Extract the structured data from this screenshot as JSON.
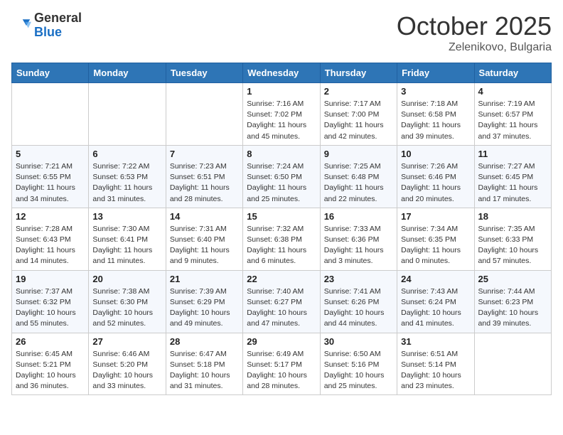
{
  "header": {
    "logo_general": "General",
    "logo_blue": "Blue",
    "month": "October 2025",
    "location": "Zelenikovo, Bulgaria"
  },
  "weekdays": [
    "Sunday",
    "Monday",
    "Tuesday",
    "Wednesday",
    "Thursday",
    "Friday",
    "Saturday"
  ],
  "weeks": [
    [
      {
        "day": "",
        "info": ""
      },
      {
        "day": "",
        "info": ""
      },
      {
        "day": "",
        "info": ""
      },
      {
        "day": "1",
        "info": "Sunrise: 7:16 AM\nSunset: 7:02 PM\nDaylight: 11 hours and 45 minutes."
      },
      {
        "day": "2",
        "info": "Sunrise: 7:17 AM\nSunset: 7:00 PM\nDaylight: 11 hours and 42 minutes."
      },
      {
        "day": "3",
        "info": "Sunrise: 7:18 AM\nSunset: 6:58 PM\nDaylight: 11 hours and 39 minutes."
      },
      {
        "day": "4",
        "info": "Sunrise: 7:19 AM\nSunset: 6:57 PM\nDaylight: 11 hours and 37 minutes."
      }
    ],
    [
      {
        "day": "5",
        "info": "Sunrise: 7:21 AM\nSunset: 6:55 PM\nDaylight: 11 hours and 34 minutes."
      },
      {
        "day": "6",
        "info": "Sunrise: 7:22 AM\nSunset: 6:53 PM\nDaylight: 11 hours and 31 minutes."
      },
      {
        "day": "7",
        "info": "Sunrise: 7:23 AM\nSunset: 6:51 PM\nDaylight: 11 hours and 28 minutes."
      },
      {
        "day": "8",
        "info": "Sunrise: 7:24 AM\nSunset: 6:50 PM\nDaylight: 11 hours and 25 minutes."
      },
      {
        "day": "9",
        "info": "Sunrise: 7:25 AM\nSunset: 6:48 PM\nDaylight: 11 hours and 22 minutes."
      },
      {
        "day": "10",
        "info": "Sunrise: 7:26 AM\nSunset: 6:46 PM\nDaylight: 11 hours and 20 minutes."
      },
      {
        "day": "11",
        "info": "Sunrise: 7:27 AM\nSunset: 6:45 PM\nDaylight: 11 hours and 17 minutes."
      }
    ],
    [
      {
        "day": "12",
        "info": "Sunrise: 7:28 AM\nSunset: 6:43 PM\nDaylight: 11 hours and 14 minutes."
      },
      {
        "day": "13",
        "info": "Sunrise: 7:30 AM\nSunset: 6:41 PM\nDaylight: 11 hours and 11 minutes."
      },
      {
        "day": "14",
        "info": "Sunrise: 7:31 AM\nSunset: 6:40 PM\nDaylight: 11 hours and 9 minutes."
      },
      {
        "day": "15",
        "info": "Sunrise: 7:32 AM\nSunset: 6:38 PM\nDaylight: 11 hours and 6 minutes."
      },
      {
        "day": "16",
        "info": "Sunrise: 7:33 AM\nSunset: 6:36 PM\nDaylight: 11 hours and 3 minutes."
      },
      {
        "day": "17",
        "info": "Sunrise: 7:34 AM\nSunset: 6:35 PM\nDaylight: 11 hours and 0 minutes."
      },
      {
        "day": "18",
        "info": "Sunrise: 7:35 AM\nSunset: 6:33 PM\nDaylight: 10 hours and 57 minutes."
      }
    ],
    [
      {
        "day": "19",
        "info": "Sunrise: 7:37 AM\nSunset: 6:32 PM\nDaylight: 10 hours and 55 minutes."
      },
      {
        "day": "20",
        "info": "Sunrise: 7:38 AM\nSunset: 6:30 PM\nDaylight: 10 hours and 52 minutes."
      },
      {
        "day": "21",
        "info": "Sunrise: 7:39 AM\nSunset: 6:29 PM\nDaylight: 10 hours and 49 minutes."
      },
      {
        "day": "22",
        "info": "Sunrise: 7:40 AM\nSunset: 6:27 PM\nDaylight: 10 hours and 47 minutes."
      },
      {
        "day": "23",
        "info": "Sunrise: 7:41 AM\nSunset: 6:26 PM\nDaylight: 10 hours and 44 minutes."
      },
      {
        "day": "24",
        "info": "Sunrise: 7:43 AM\nSunset: 6:24 PM\nDaylight: 10 hours and 41 minutes."
      },
      {
        "day": "25",
        "info": "Sunrise: 7:44 AM\nSunset: 6:23 PM\nDaylight: 10 hours and 39 minutes."
      }
    ],
    [
      {
        "day": "26",
        "info": "Sunrise: 6:45 AM\nSunset: 5:21 PM\nDaylight: 10 hours and 36 minutes."
      },
      {
        "day": "27",
        "info": "Sunrise: 6:46 AM\nSunset: 5:20 PM\nDaylight: 10 hours and 33 minutes."
      },
      {
        "day": "28",
        "info": "Sunrise: 6:47 AM\nSunset: 5:18 PM\nDaylight: 10 hours and 31 minutes."
      },
      {
        "day": "29",
        "info": "Sunrise: 6:49 AM\nSunset: 5:17 PM\nDaylight: 10 hours and 28 minutes."
      },
      {
        "day": "30",
        "info": "Sunrise: 6:50 AM\nSunset: 5:16 PM\nDaylight: 10 hours and 25 minutes."
      },
      {
        "day": "31",
        "info": "Sunrise: 6:51 AM\nSunset: 5:14 PM\nDaylight: 10 hours and 23 minutes."
      },
      {
        "day": "",
        "info": ""
      }
    ]
  ]
}
